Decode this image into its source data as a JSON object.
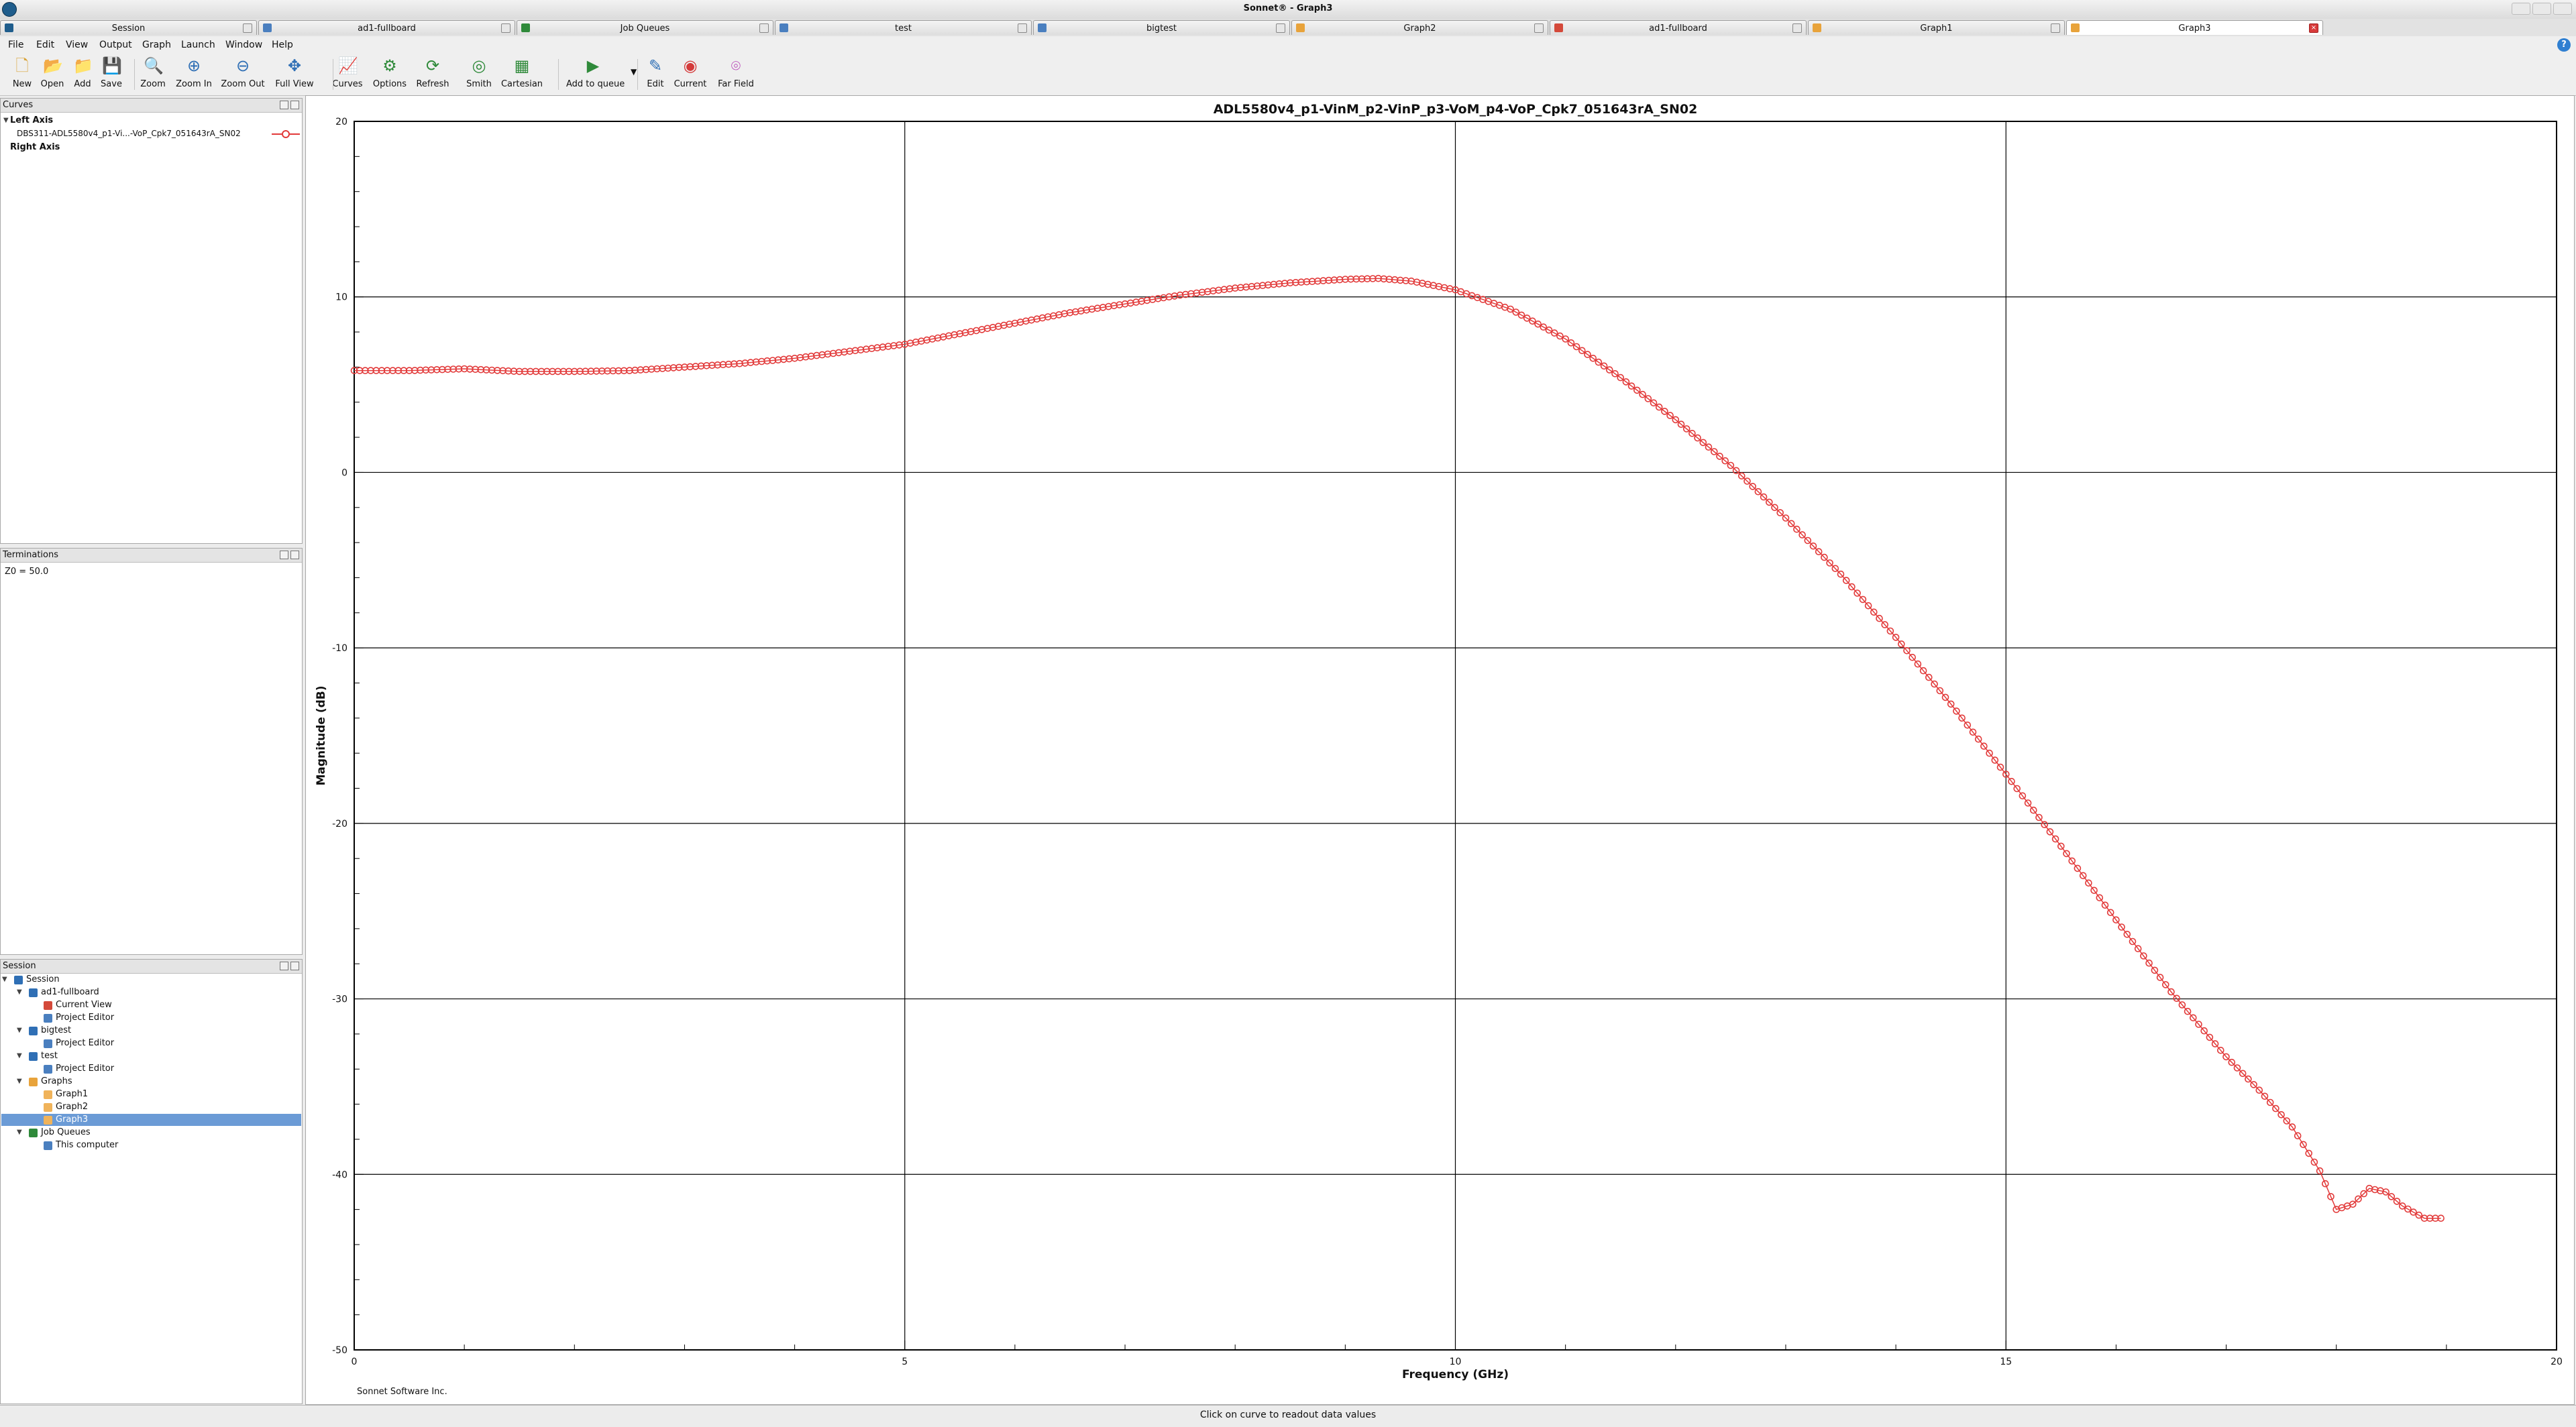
{
  "window": {
    "title": "Sonnet® - Graph3"
  },
  "tabs": [
    {
      "label": "Session",
      "active": false
    },
    {
      "label": "ad1-fullboard",
      "active": false
    },
    {
      "label": "Job Queues",
      "active": false
    },
    {
      "label": "test",
      "active": false
    },
    {
      "label": "bigtest",
      "active": false
    },
    {
      "label": "Graph2",
      "active": false
    },
    {
      "label": "ad1-fullboard",
      "active": false
    },
    {
      "label": "Graph1",
      "active": false
    },
    {
      "label": "Graph3",
      "active": true
    }
  ],
  "menu": [
    "File",
    "Edit",
    "View",
    "Output",
    "Graph",
    "Launch",
    "Window",
    "Help"
  ],
  "toolbar": [
    {
      "label": "New",
      "icon": "new-icon"
    },
    {
      "label": "Open",
      "icon": "open-icon"
    },
    {
      "label": "Add",
      "icon": "add-icon"
    },
    {
      "label": "Save",
      "icon": "save-icon"
    },
    {
      "label": "Zoom",
      "icon": "zoom-icon"
    },
    {
      "label": "Zoom In",
      "icon": "zoom-in-icon"
    },
    {
      "label": "Zoom Out",
      "icon": "zoom-out-icon"
    },
    {
      "label": "Full View",
      "icon": "full-view-icon"
    },
    {
      "label": "Curves",
      "icon": "curves-icon"
    },
    {
      "label": "Options",
      "icon": "options-icon"
    },
    {
      "label": "Refresh",
      "icon": "refresh-icon"
    },
    {
      "label": "Smith",
      "icon": "smith-icon"
    },
    {
      "label": "Cartesian",
      "icon": "cartesian-icon"
    },
    {
      "label": "Add to queue",
      "icon": "add-to-queue-icon"
    },
    {
      "label": "Edit",
      "icon": "edit-icon"
    },
    {
      "label": "Current",
      "icon": "current-icon"
    },
    {
      "label": "Far Field",
      "icon": "far-field-icon"
    }
  ],
  "curves_panel": {
    "title": "Curves",
    "left_axis": "Left Axis",
    "curve_name": "DBS311-ADL5580v4_p1-Vi...-VoP_Cpk7_051643rA_SN02",
    "right_axis": "Right Axis"
  },
  "terminations_panel": {
    "title": "Terminations",
    "value": "Z0 = 50.0"
  },
  "session_panel": {
    "title": "Session",
    "tree": [
      {
        "label": "Session",
        "depth": 0,
        "expanded": true,
        "icon": "session-icon"
      },
      {
        "label": "ad1-fullboard",
        "depth": 1,
        "expanded": true,
        "icon": "project-icon"
      },
      {
        "label": "Current View",
        "depth": 2,
        "icon": "current-view-icon"
      },
      {
        "label": "Project Editor",
        "depth": 2,
        "icon": "project-editor-icon"
      },
      {
        "label": "bigtest",
        "depth": 1,
        "expanded": true,
        "icon": "project-icon"
      },
      {
        "label": "Project Editor",
        "depth": 2,
        "icon": "project-editor-icon"
      },
      {
        "label": "test",
        "depth": 1,
        "expanded": true,
        "icon": "project-icon"
      },
      {
        "label": "Project Editor",
        "depth": 2,
        "icon": "project-editor-icon"
      },
      {
        "label": "Graphs",
        "depth": 1,
        "expanded": true,
        "icon": "graphs-folder-icon"
      },
      {
        "label": "Graph1",
        "depth": 2,
        "icon": "graph-icon"
      },
      {
        "label": "Graph2",
        "depth": 2,
        "icon": "graph-icon"
      },
      {
        "label": "Graph3",
        "depth": 2,
        "icon": "graph-icon",
        "selected": true
      },
      {
        "label": "Job Queues",
        "depth": 1,
        "expanded": true,
        "icon": "job-queues-icon"
      },
      {
        "label": "This computer",
        "depth": 2,
        "icon": "computer-icon"
      }
    ]
  },
  "chart_data": {
    "type": "line",
    "title": "ADL5580v4_p1-VinM_p2-VinP_p3-VoM_p4-VoP_Cpk7_051643rA_SN02",
    "xlabel": "Frequency (GHz)",
    "ylabel": "Magnitude (dB)",
    "xlim": [
      0,
      20
    ],
    "ylim": [
      -50,
      20
    ],
    "xticks": [
      0,
      5,
      10,
      15,
      20
    ],
    "yticks": [
      20,
      10,
      0,
      -10,
      -20,
      -30,
      -40,
      -50
    ],
    "grid": true,
    "marker": "open-circle",
    "color": "#e23a3a",
    "footer": "Sonnet Software Inc.",
    "series": [
      {
        "points": [
          [
            0.0,
            5.8
          ],
          [
            0.5,
            5.8
          ],
          [
            1.0,
            5.9
          ],
          [
            1.5,
            5.75
          ],
          [
            2.0,
            5.75
          ],
          [
            2.5,
            5.8
          ],
          [
            3.0,
            6.0
          ],
          [
            3.5,
            6.2
          ],
          [
            4.0,
            6.5
          ],
          [
            4.5,
            6.9
          ],
          [
            5.0,
            7.3
          ],
          [
            5.5,
            7.9
          ],
          [
            6.0,
            8.5
          ],
          [
            6.5,
            9.1
          ],
          [
            7.0,
            9.6
          ],
          [
            7.5,
            10.1
          ],
          [
            8.0,
            10.5
          ],
          [
            8.5,
            10.8
          ],
          [
            9.0,
            11.0
          ],
          [
            9.3,
            11.05
          ],
          [
            9.6,
            10.9
          ],
          [
            10.0,
            10.4
          ],
          [
            10.5,
            9.3
          ],
          [
            11.0,
            7.6
          ],
          [
            11.5,
            5.4
          ],
          [
            12.0,
            3.0
          ],
          [
            12.5,
            0.4
          ],
          [
            13.0,
            -2.6
          ],
          [
            13.5,
            -5.8
          ],
          [
            14.0,
            -9.4
          ],
          [
            14.5,
            -13.2
          ],
          [
            15.0,
            -17.2
          ],
          [
            15.5,
            -21.3
          ],
          [
            16.0,
            -25.5
          ],
          [
            16.5,
            -29.6
          ],
          [
            17.0,
            -33.3
          ],
          [
            17.3,
            -35.2
          ],
          [
            17.6,
            -37.3
          ],
          [
            17.85,
            -39.8
          ],
          [
            18.0,
            -42.0
          ],
          [
            18.15,
            -41.7
          ],
          [
            18.3,
            -40.8
          ],
          [
            18.45,
            -41.0
          ],
          [
            18.6,
            -41.8
          ],
          [
            18.8,
            -42.5
          ],
          [
            18.95,
            -42.5
          ]
        ]
      }
    ]
  },
  "status": {
    "text": "Click on curve to readout data values"
  }
}
